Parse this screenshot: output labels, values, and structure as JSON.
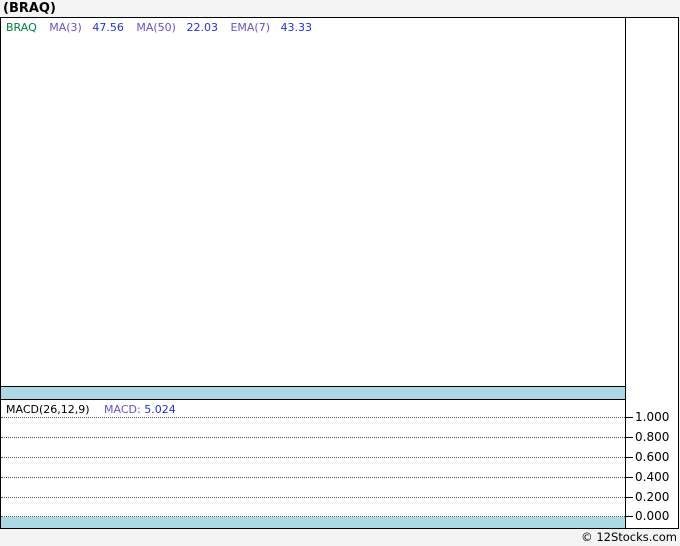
{
  "title": "(BRAQ)",
  "legend": {
    "symbol": "BRAQ",
    "items": [
      {
        "label": "MA(3)",
        "value": "47.56"
      },
      {
        "label": "MA(50)",
        "value": "22.03"
      },
      {
        "label": "EMA(7)",
        "value": "43.33"
      }
    ]
  },
  "macd_panel": {
    "params_label": "MACD(26,12,9)",
    "macd_label": "MACD:",
    "macd_value": "5.024"
  },
  "axis": {
    "ticks": [
      "1.000",
      "0.800",
      "0.600",
      "0.400",
      "0.200",
      "0.000"
    ]
  },
  "footer": {
    "copyright": "© 12Stocks.com"
  },
  "colors": {
    "page_background": "#f4f4f4",
    "panel_background": "#ffffff",
    "separator_bar_blue": "#add8e6",
    "symbol_green": "#008040",
    "indicator_label_blue": "#6055cc",
    "indicator_value_blue": "#2530dd",
    "border_black": "#000000"
  },
  "chart_data": {
    "type": "line",
    "title": "(BRAQ)",
    "main_panel": {
      "series": [
        {
          "name": "BRAQ",
          "color": "#008040",
          "latest": null
        },
        {
          "name": "MA(3)",
          "latest": 47.56
        },
        {
          "name": "MA(50)",
          "latest": 22.03
        },
        {
          "name": "EMA(7)",
          "latest": 43.33
        }
      ],
      "visible_data_points": [],
      "plot_area_empty": true
    },
    "indicator_panel": {
      "name": "MACD(26,12,9)",
      "latest": 5.024,
      "ylim": [
        0.0,
        1.0
      ],
      "y_ticks": [
        1.0,
        0.8,
        0.6,
        0.4,
        0.2,
        0.0
      ],
      "grid": "dotted-horizontal",
      "visible_data_points": []
    },
    "legend_position": "top-left",
    "source": "12Stocks.com"
  }
}
